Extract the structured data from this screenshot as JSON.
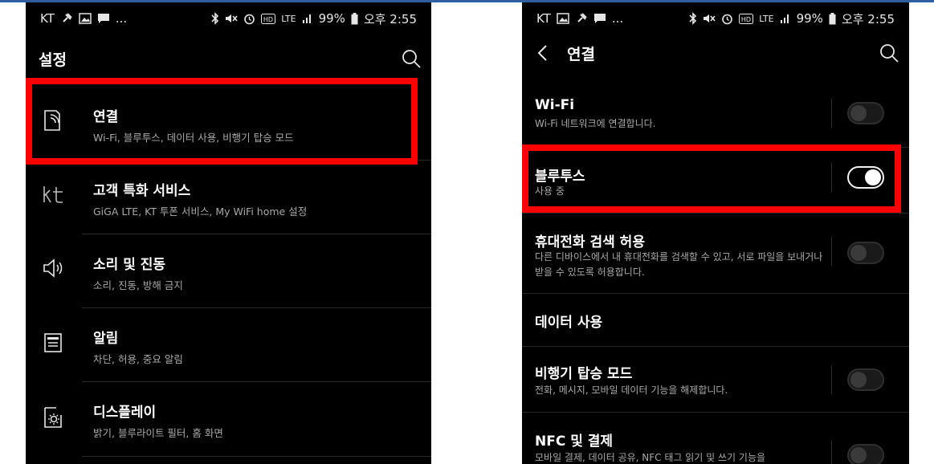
{
  "status_bar": {
    "carrier": "KT",
    "more": "...",
    "network": "LTE",
    "battery": "99%",
    "time": "오후 2:55"
  },
  "left_screen": {
    "title": "설정",
    "items": [
      {
        "title": "연결",
        "subtitle": "Wi-Fi, 블루투스, 데이터 사용, 비행기 탑승 모드",
        "icon": "connections-icon"
      },
      {
        "title": "고객 특화 서비스",
        "subtitle": "GiGA LTE, KT 투폰 서비스, My WiFi home 설정",
        "icon": "kt-logo-icon"
      },
      {
        "title": "소리 및 진동",
        "subtitle": "소리, 진동, 방해 금지",
        "icon": "speaker-icon"
      },
      {
        "title": "알림",
        "subtitle": "차단, 허용, 중요 알림",
        "icon": "notification-icon"
      },
      {
        "title": "디스플레이",
        "subtitle": "밝기, 블루라이트 필터, 홈 화면",
        "icon": "display-brightness-icon"
      }
    ]
  },
  "right_screen": {
    "title": "연결",
    "items": [
      {
        "title": "Wi-Fi",
        "subtitle": "Wi-Fi 네트워크에 연결합니다.",
        "toggle": false
      },
      {
        "title": "블루투스",
        "subtitle": "사용 중",
        "toggle": true
      },
      {
        "title": "휴대전화 검색 허용",
        "subtitle": "다른 디바이스에서 내 휴대전화를 검색할 수 있고, 서로 파일을 보내거나 받을 수 있도록 허용합니다.",
        "toggle": false
      },
      {
        "title": "데이터 사용"
      },
      {
        "title": "비행기 탑승 모드",
        "subtitle": "전화, 메시지, 모바일 데이터 기능을 해제합니다.",
        "toggle": false
      },
      {
        "title": "NFC 및 결제",
        "subtitle": "모바일 결제, 데이터 공유, NFC 태그 읽기 및 쓰기 기능을",
        "toggle": false
      }
    ]
  },
  "colors": {
    "highlight": "#ff0000",
    "background": "#000000",
    "subtitle": "#a8a8a8"
  }
}
